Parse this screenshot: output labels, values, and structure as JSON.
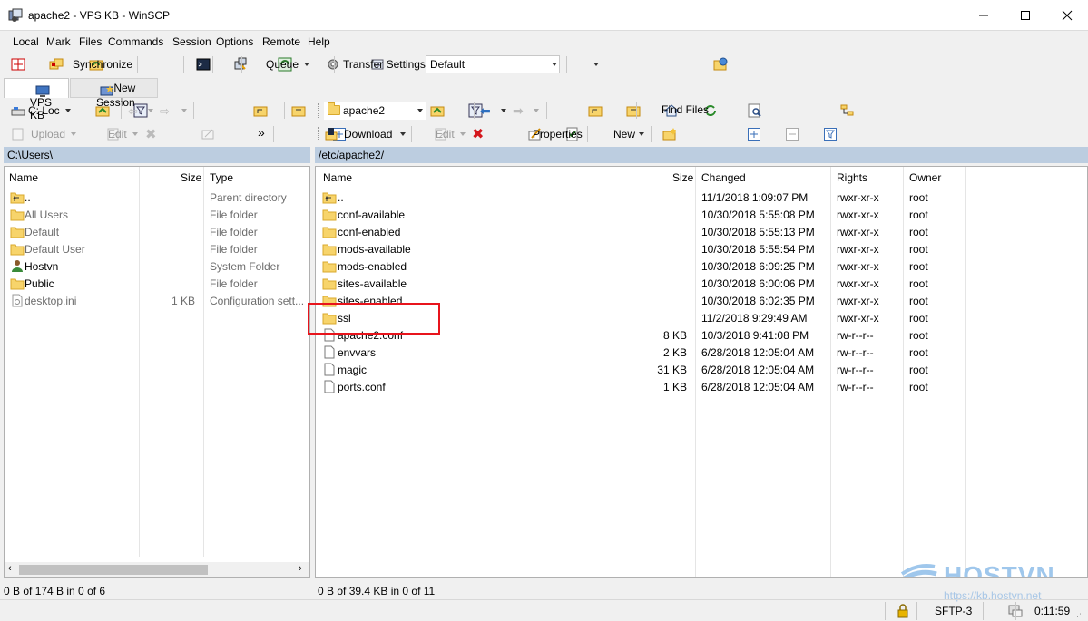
{
  "window": {
    "title": "apache2 - VPS KB - WinSCP"
  },
  "menu": [
    "Local",
    "Mark",
    "Files",
    "Commands",
    "Session",
    "Options",
    "Remote",
    "Help"
  ],
  "toolbar": {
    "synchronize": "Synchronize",
    "queue": "Queue",
    "transfer_settings_label": "Transfer Settings",
    "transfer_settings_value": "Default"
  },
  "tabs": {
    "session": "VPS KB",
    "new_session": "New Session"
  },
  "local": {
    "drive": "C: Loc",
    "upload": "Upload",
    "edit": "Edit",
    "path": "C:\\Users\\",
    "columns": {
      "name": "Name",
      "size": "Size",
      "type": "Type"
    },
    "rows": [
      {
        "name": "..",
        "size": "",
        "type": "Parent directory",
        "icon": "parent-dir-icon",
        "dim": false
      },
      {
        "name": "All Users",
        "size": "",
        "type": "File folder",
        "icon": "folder-icon",
        "dim": true
      },
      {
        "name": "Default",
        "size": "",
        "type": "File folder",
        "icon": "folder-icon",
        "dim": true
      },
      {
        "name": "Default User",
        "size": "",
        "type": "File folder",
        "icon": "folder-icon",
        "dim": true
      },
      {
        "name": "Hostvn",
        "size": "",
        "type": "System Folder",
        "icon": "user-folder-icon",
        "dim": false
      },
      {
        "name": "Public",
        "size": "",
        "type": "File folder",
        "icon": "folder-icon",
        "dim": false
      },
      {
        "name": "desktop.ini",
        "size": "1 KB",
        "type": "Configuration sett...",
        "icon": "settings-file-icon",
        "dim": true
      }
    ],
    "status": "0 B of 174 B in 0 of 6"
  },
  "remote": {
    "dir": "apache2",
    "download": "Download",
    "edit": "Edit",
    "properties": "Properties",
    "new": "New",
    "find_files": "Find Files",
    "path": "/etc/apache2/",
    "columns": {
      "name": "Name",
      "size": "Size",
      "changed": "Changed",
      "rights": "Rights",
      "owner": "Owner"
    },
    "rows": [
      {
        "name": "..",
        "size": "",
        "changed": "11/1/2018 1:09:07 PM",
        "rights": "rwxr-xr-x",
        "owner": "root",
        "icon": "parent-dir-icon"
      },
      {
        "name": "conf-available",
        "size": "",
        "changed": "10/30/2018 5:55:08 PM",
        "rights": "rwxr-xr-x",
        "owner": "root",
        "icon": "folder-icon"
      },
      {
        "name": "conf-enabled",
        "size": "",
        "changed": "10/30/2018 5:55:13 PM",
        "rights": "rwxr-xr-x",
        "owner": "root",
        "icon": "folder-icon"
      },
      {
        "name": "mods-available",
        "size": "",
        "changed": "10/30/2018 5:55:54 PM",
        "rights": "rwxr-xr-x",
        "owner": "root",
        "icon": "folder-icon"
      },
      {
        "name": "mods-enabled",
        "size": "",
        "changed": "10/30/2018 6:09:25 PM",
        "rights": "rwxr-xr-x",
        "owner": "root",
        "icon": "folder-icon"
      },
      {
        "name": "sites-available",
        "size": "",
        "changed": "10/30/2018 6:00:06 PM",
        "rights": "rwxr-xr-x",
        "owner": "root",
        "icon": "folder-icon"
      },
      {
        "name": "sites-enabled",
        "size": "",
        "changed": "10/30/2018 6:02:35 PM",
        "rights": "rwxr-xr-x",
        "owner": "root",
        "icon": "folder-icon"
      },
      {
        "name": "ssl",
        "size": "",
        "changed": "11/2/2018 9:29:49 AM",
        "rights": "rwxr-xr-x",
        "owner": "root",
        "icon": "folder-icon"
      },
      {
        "name": "apache2.conf",
        "size": "8 KB",
        "changed": "10/3/2018 9:41:08 PM",
        "rights": "rw-r--r--",
        "owner": "root",
        "icon": "file-icon"
      },
      {
        "name": "envvars",
        "size": "2 KB",
        "changed": "6/28/2018 12:05:04 AM",
        "rights": "rw-r--r--",
        "owner": "root",
        "icon": "file-icon"
      },
      {
        "name": "magic",
        "size": "31 KB",
        "changed": "6/28/2018 12:05:04 AM",
        "rights": "rw-r--r--",
        "owner": "root",
        "icon": "file-icon"
      },
      {
        "name": "ports.conf",
        "size": "1 KB",
        "changed": "6/28/2018 12:05:04 AM",
        "rights": "rw-r--r--",
        "owner": "root",
        "icon": "file-icon"
      }
    ],
    "status": "0 B of 39.4 KB in 0 of 11"
  },
  "statusbar": {
    "protocol": "SFTP-3",
    "time": "0:11:59"
  },
  "watermark": {
    "brand": "HOSTVN",
    "url": "https://kb.hostvn.net"
  },
  "colors": {
    "path_bar": "#bccde0",
    "highlight": "#e8141c",
    "folder": "#f7d46b"
  }
}
